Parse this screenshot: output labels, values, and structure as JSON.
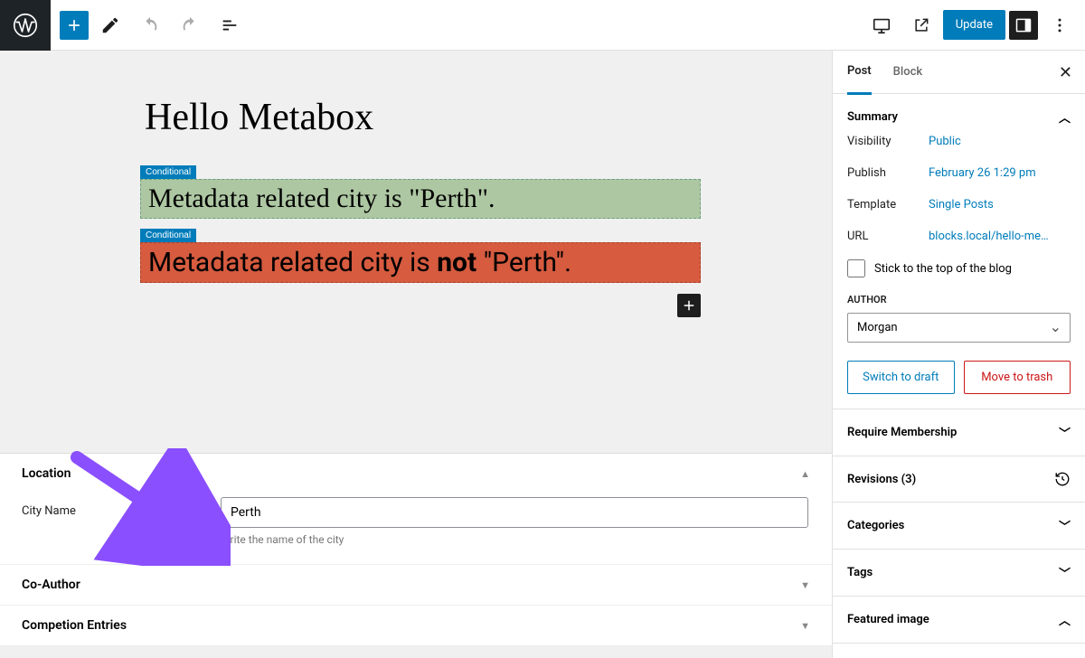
{
  "toolbar": {
    "update_label": "Update"
  },
  "editor": {
    "title": "Hello Metabox",
    "block1_label": "Conditional",
    "block1_text": "Metadata related city is \"Perth\".",
    "block2_label": "Conditional",
    "block2_text_pre": "Metadata related city is ",
    "block2_text_bold": "not",
    "block2_text_post": " \"Perth\"."
  },
  "metaboxes": {
    "location": {
      "title": "Location",
      "field_label": "City Name",
      "field_value": "Perth",
      "field_desc": "Write the name of the city"
    },
    "coauthor": {
      "title": "Co-Author"
    },
    "competion": {
      "title": "Competion Entries"
    }
  },
  "sidebar": {
    "tabs": {
      "post": "Post",
      "block": "Block"
    },
    "summary": {
      "title": "Summary",
      "visibility_label": "Visibility",
      "visibility_value": "Public",
      "publish_label": "Publish",
      "publish_value": "February 26 1:29 pm",
      "template_label": "Template",
      "template_value": "Single Posts",
      "url_label": "URL",
      "url_value": "blocks.local/hello-me…",
      "stick_label": "Stick to the top of the blog",
      "author_label": "AUTHOR",
      "author_value": "Morgan",
      "draft_label": "Switch to draft",
      "trash_label": "Move to trash"
    },
    "panels": {
      "require_membership": "Require Membership",
      "revisions": "Revisions (3)",
      "categories": "Categories",
      "tags": "Tags",
      "featured_image": "Featured image"
    }
  }
}
